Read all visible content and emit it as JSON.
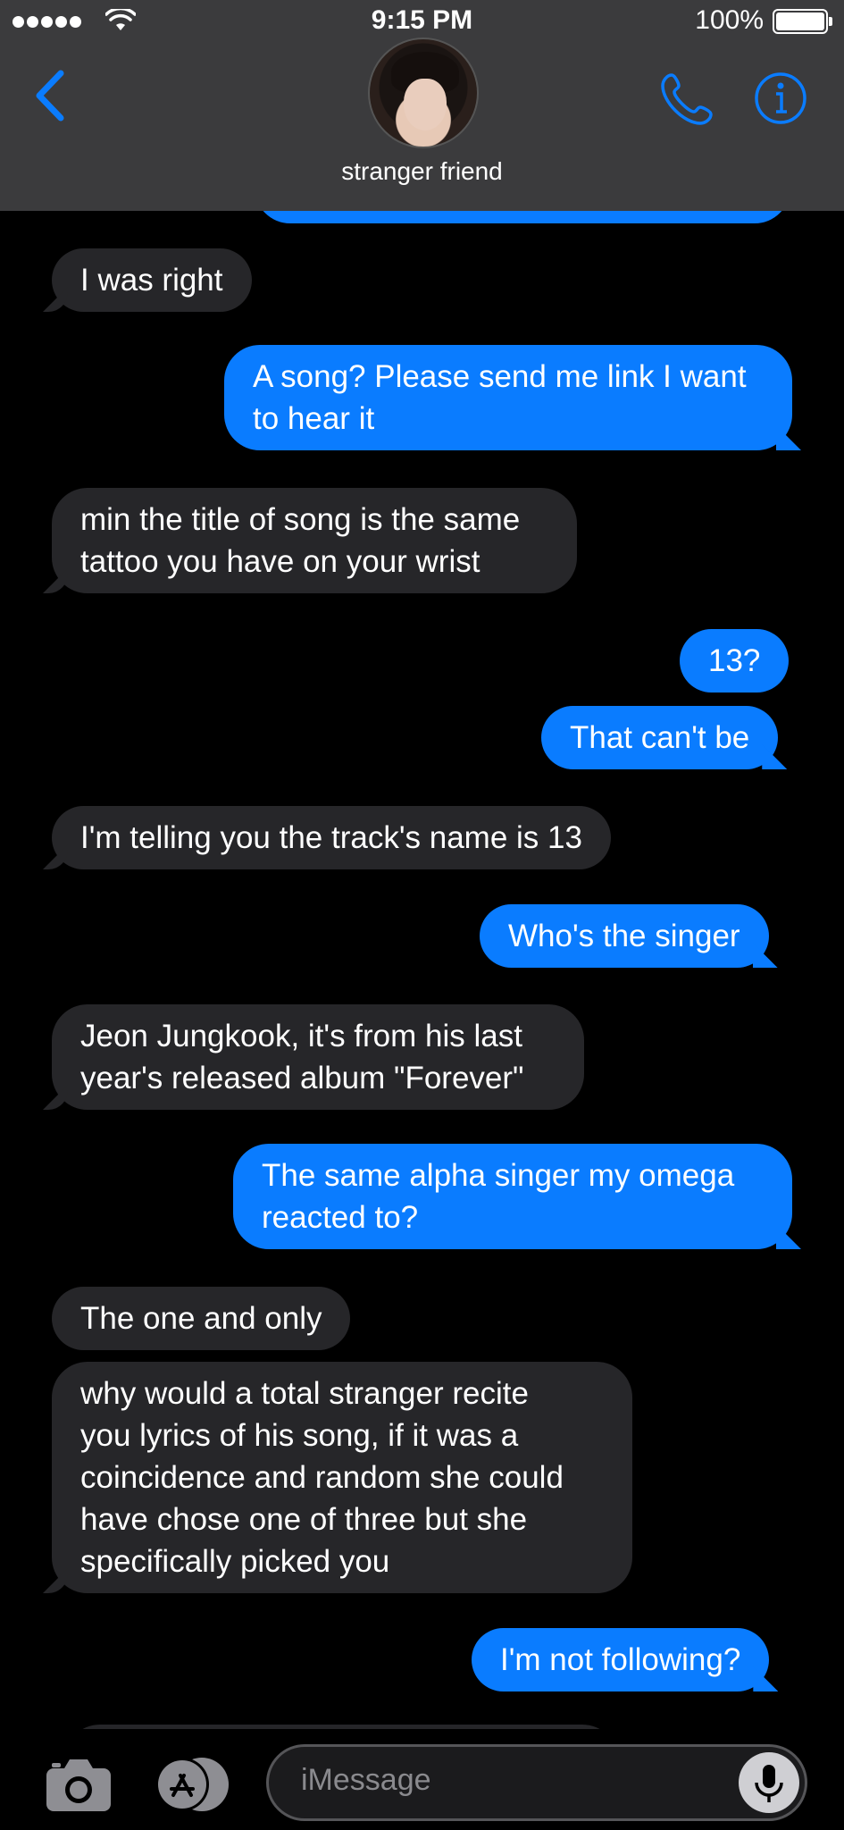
{
  "status_bar": {
    "time": "9:15 PM",
    "battery": "100%"
  },
  "header": {
    "contact_name": "stranger friend"
  },
  "messages": [
    {
      "from": "them",
      "text": "I was right"
    },
    {
      "from": "me",
      "lines": [
        "A song? Please send me link I want",
        "to hear it"
      ]
    },
    {
      "from": "them",
      "lines": [
        "min the title of song is the same",
        "tattoo you have on your wrist"
      ]
    },
    {
      "from": "me",
      "text": "13?"
    },
    {
      "from": "me",
      "text": "That can't be"
    },
    {
      "from": "them",
      "text": "I'm telling you the track's name is 13"
    },
    {
      "from": "me",
      "text": "Who's the singer"
    },
    {
      "from": "them",
      "lines": [
        "Jeon Jungkook, it's from his last",
        "year's released album \"Forever\""
      ]
    },
    {
      "from": "me",
      "lines": [
        "The same alpha singer my omega",
        "reacted to?"
      ]
    },
    {
      "from": "them",
      "text": "The one and only"
    },
    {
      "from": "them",
      "lines": [
        "why would a total stranger recite",
        "you lyrics of his song, if it was a",
        "coincidence and random she could",
        "have chose one of three but she",
        "specifically picked you"
      ]
    },
    {
      "from": "me",
      "text": "I'm not following?"
    }
  ],
  "input": {
    "placeholder": "iMessage"
  },
  "icons": {
    "back": "chevron-left-icon",
    "call": "phone-icon",
    "info": "info-icon",
    "camera": "camera-icon",
    "apps": "app-store-icon",
    "mic": "microphone-icon"
  },
  "colors": {
    "accent": "#0a7cff",
    "incoming_bubble": "#262629",
    "header": "#3b3b3d"
  }
}
